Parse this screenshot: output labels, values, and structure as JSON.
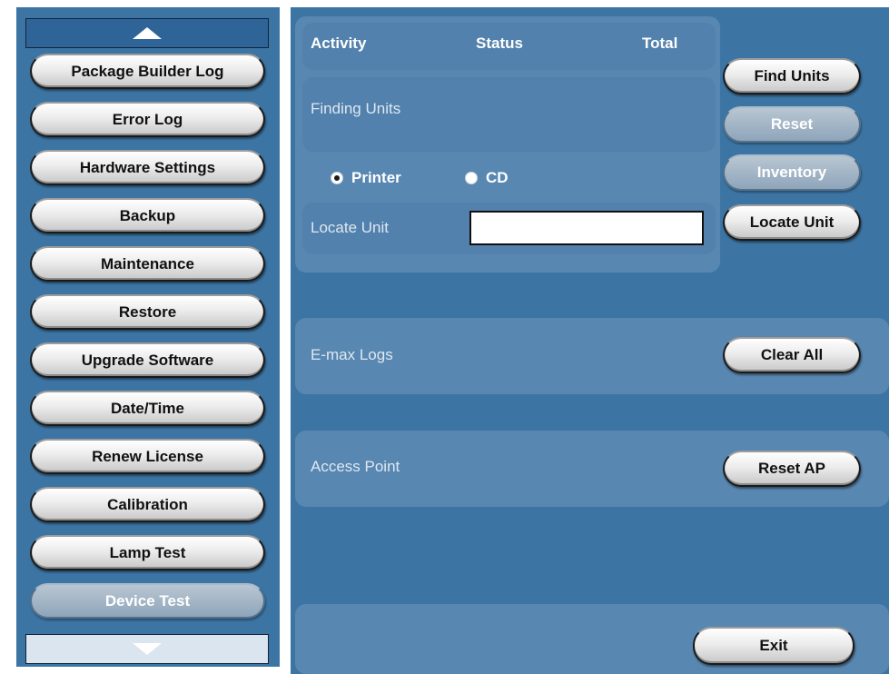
{
  "sidebar": {
    "items": [
      {
        "label": "Package Builder Log",
        "enabled": true
      },
      {
        "label": "Error Log",
        "enabled": true
      },
      {
        "label": "Hardware Settings",
        "enabled": true
      },
      {
        "label": "Backup",
        "enabled": true
      },
      {
        "label": "Maintenance",
        "enabled": true
      },
      {
        "label": "Restore",
        "enabled": true
      },
      {
        "label": "Upgrade Software",
        "enabled": true
      },
      {
        "label": "Date/Time",
        "enabled": true
      },
      {
        "label": "Renew License",
        "enabled": true
      },
      {
        "label": "Calibration",
        "enabled": true
      },
      {
        "label": "Lamp Test",
        "enabled": true
      },
      {
        "label": "Device Test",
        "enabled": false
      }
    ],
    "scroll_up_icon": "triangle-up-icon",
    "scroll_down_icon": "triangle-down-icon"
  },
  "activity": {
    "headers": {
      "activity": "Activity",
      "status": "Status",
      "total": "Total"
    },
    "status_text": "Finding Units"
  },
  "output": {
    "options": [
      {
        "label": "Printer",
        "selected": true
      },
      {
        "label": "CD",
        "selected": false
      }
    ]
  },
  "locate": {
    "label": "Locate Unit",
    "input_value": ""
  },
  "buttons": {
    "find_units": "Find Units",
    "reset": "Reset",
    "inventory": "Inventory",
    "locate_unit": "Locate Unit",
    "clear_all": "Clear All",
    "reset_ap": "Reset AP",
    "exit": "Exit"
  },
  "sections": {
    "emax_logs": "E-max Logs",
    "access_point": "Access Point"
  },
  "colors": {
    "panel_blue": "#3c75a4",
    "box_blue": "#5181ac",
    "disabled_button": "#8ea5ba"
  }
}
